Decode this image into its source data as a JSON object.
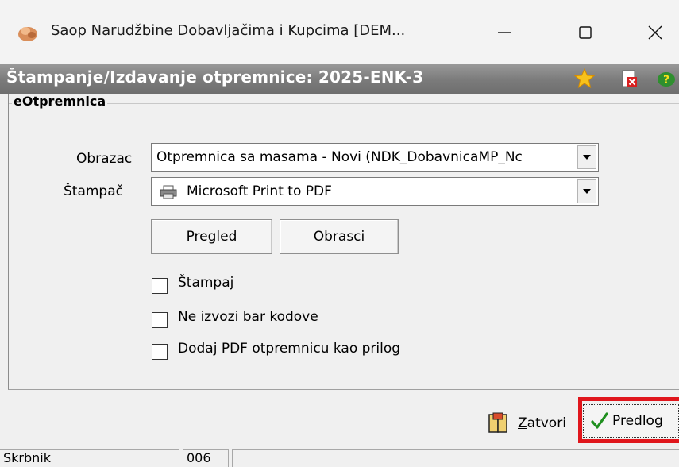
{
  "window": {
    "title": "Saop  Narudžbine Dobavljačima i Kupcima [DEM...",
    "app_icon": "saop-app-icon",
    "controls": [
      "minimize-icon",
      "maximize-icon",
      "close-icon"
    ]
  },
  "header": {
    "title": "Štampanje/Izdavanje otpremnice: 2025-ENK-3",
    "icons": [
      "star-icon",
      "delete-document-icon",
      "help-icon"
    ]
  },
  "group": {
    "label": "eOtpremnica"
  },
  "form": {
    "obrazac_label": "Obrazac",
    "obrazac_value": "Otpremnica sa masama - Novi  (NDK_DobavnicaMP_Nc",
    "stampac_label": "Štampač",
    "stampac_value": "Microsoft Print to PDF",
    "pregled_button": "Pregled",
    "obrasci_button": "Obrasci",
    "checkboxes": [
      {
        "label": "Štampaj",
        "checked": false
      },
      {
        "label": "Ne izvozi bar kodove",
        "checked": false
      },
      {
        "label": "Dodaj PDF otpremnicu kao prilog",
        "checked": false
      }
    ]
  },
  "footer": {
    "zatvori_first": "Z",
    "zatvori_rest": "atvori",
    "predlog_main": "Predlo",
    "predlog_u": "g",
    "highlight_color": "#e0161c"
  },
  "statusbar": {
    "user": "Skrbnik",
    "code": "006",
    "extra": ""
  },
  "colors": {
    "header_band": "#7b7b7b",
    "check_green": "#1f8f1f"
  }
}
